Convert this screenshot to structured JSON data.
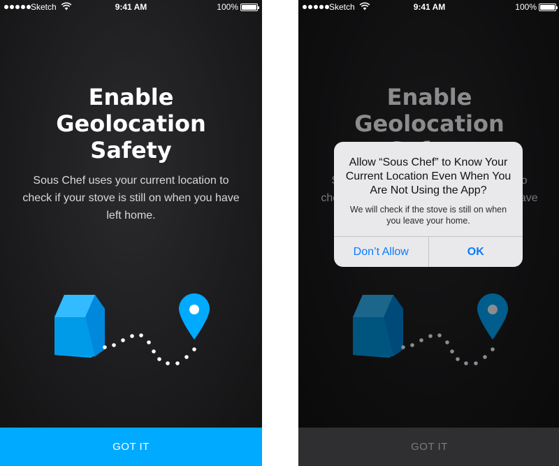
{
  "status_bar": {
    "carrier": "Sketch",
    "time": "9:41 AM",
    "battery": "100%",
    "battery_level": 1.0,
    "signal_icon": "signal-dots-icon",
    "wifi_icon": "wifi-icon"
  },
  "screen": {
    "title_lines": [
      "Enable",
      "Geolocation",
      "Safety"
    ],
    "subtitle": "Sous Chef uses your current location to check if your stove is still on when you have left home.",
    "cta_label": "GOT IT",
    "illustration": {
      "house_icon": "house-icon",
      "pin_icon": "location-pin-icon",
      "path_icon": "dotted-path-icon"
    }
  },
  "alert": {
    "title": "Allow “Sous Chef” to Know Your Current Location Even When You Are Not Using the App?",
    "message": "We will check if the stove is still on when you leave your home.",
    "buttons": [
      "Don’t Allow",
      "OK"
    ]
  },
  "colors": {
    "accent": "#00aaff",
    "background": "#1b1b1d",
    "ios_blue": "#0a7aff",
    "cta_disabled": "#2f2f31"
  }
}
